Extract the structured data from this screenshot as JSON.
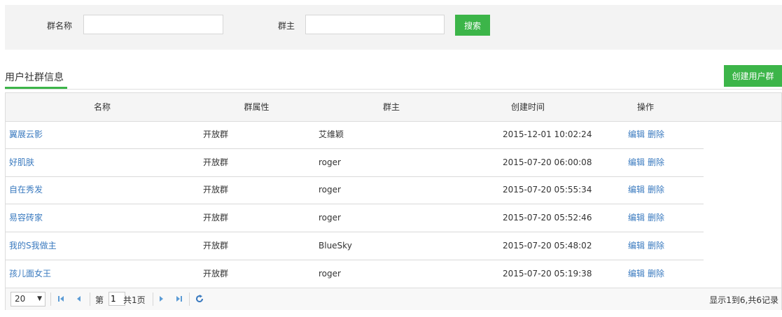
{
  "search": {
    "group_name_label": "群名称",
    "group_name_value": "",
    "owner_label": "群主",
    "owner_value": "",
    "search_button": "搜索"
  },
  "section": {
    "title": "用户社群信息",
    "create_button": "创建用户群"
  },
  "table": {
    "headers": [
      "名称",
      "群属性",
      "群主",
      "创建时间",
      "操作"
    ],
    "rows": [
      {
        "name": "翼展云影",
        "type": "开放群",
        "owner": "艾维颖",
        "created": "2015-12-01 10:02:24",
        "edit": "编辑",
        "delete": "删除"
      },
      {
        "name": "好肌肤",
        "type": "开放群",
        "owner": "roger",
        "created": "2015-07-20 06:00:08",
        "edit": "编辑",
        "delete": "删除"
      },
      {
        "name": "自在秀发",
        "type": "开放群",
        "owner": "roger",
        "created": "2015-07-20 05:55:34",
        "edit": "编辑",
        "delete": "删除"
      },
      {
        "name": "易容砖家",
        "type": "开放群",
        "owner": "roger",
        "created": "2015-07-20 05:52:46",
        "edit": "编辑",
        "delete": "删除"
      },
      {
        "name": "我的S我做主",
        "type": "开放群",
        "owner": "BlueSky",
        "created": "2015-07-20 05:48:02",
        "edit": "编辑",
        "delete": "删除"
      },
      {
        "name": "孩儿面女王",
        "type": "开放群",
        "owner": "roger",
        "created": "2015-07-20 05:19:38",
        "edit": "编辑",
        "delete": "删除"
      }
    ]
  },
  "pager": {
    "page_size": "20",
    "page_prefix": "第",
    "current_page": "1",
    "page_suffix": "共1页",
    "summary": "显示1到6,共6记录",
    "icon_color": "#5b9bd5"
  },
  "colors": {
    "accent": "#3cb549",
    "link": "#3a7abf"
  }
}
